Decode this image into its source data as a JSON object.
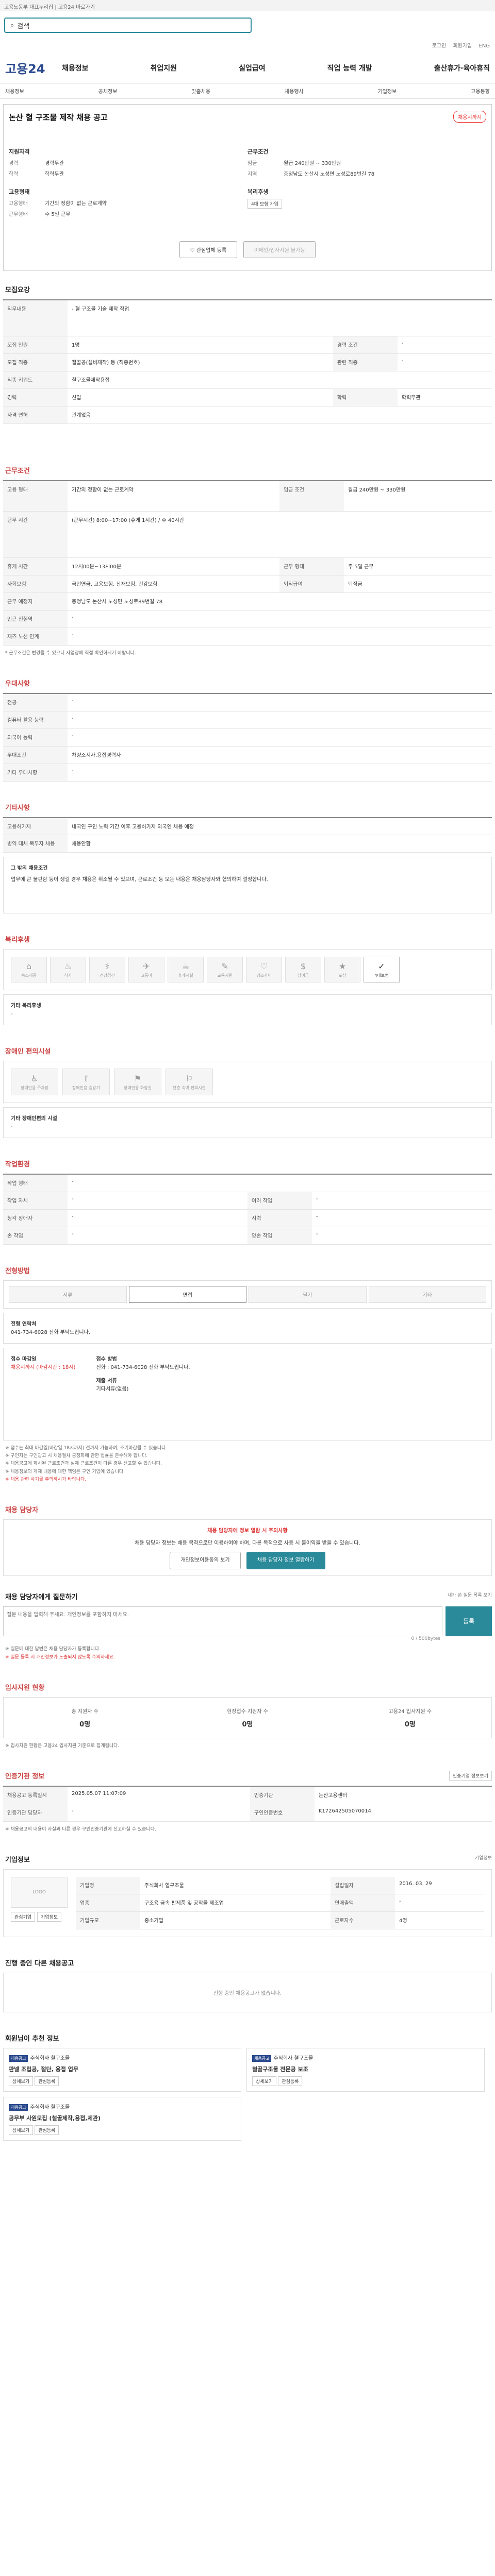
{
  "topbar": "고용노동부 대표누리집 | 고용24 바로가기",
  "search": {
    "placeholder": "검색어를 입력하세요",
    "value": "검색"
  },
  "util": [
    "로그인",
    "회원가입",
    "ENG"
  ],
  "logo": "고용24",
  "nav": [
    "채용정보",
    "취업지원",
    "실업급여",
    "직업 능력 개발",
    "출산휴가·육아휴직"
  ],
  "subnav": [
    "채용정보",
    "공채정보",
    "맞춤채용",
    "채용행사",
    "기업정보",
    "고용동향"
  ],
  "job": {
    "title": "논산 혈 구조물 제작 채용 공고",
    "badge": "채용시까지",
    "conditions_title": "지원자격",
    "cond_h": "근무조건",
    "cond": [
      {
        "k": "경력",
        "v": "경력무관"
      },
      {
        "k": "학력",
        "v": "학력무관"
      }
    ],
    "pay": [
      {
        "k": "임금",
        "v": "월급 240만원 ~ 330만원"
      },
      {
        "k": "지역",
        "v": "충청남도 논산시 노성면 노성로89번길 78"
      }
    ],
    "form_h": "고용형태",
    "form": [
      {
        "k": "고용형태",
        "v": "기간의 정함이 없는 근로계약"
      },
      {
        "k": "근무형태",
        "v": "주 5일 근무"
      }
    ],
    "period_h": "복리후생",
    "period": [
      {
        "k": "",
        "v": "4대 보험 가입"
      }
    ],
    "save": "관심업체 등록",
    "apply": "이메일/입사지원 불가능"
  },
  "sec_recruit": "모집요강",
  "recruit_rows": [
    {
      "h": "직무내용",
      "v": "- 혈 구조물 기술 제작 작업"
    },
    {
      "h": "모집 인원",
      "v": "1명",
      "h2": "경력 조건",
      "v2": "-"
    },
    {
      "h": "모집 직종",
      "v": "철골공(설비제작) 등 (직종번호)",
      "h2": "관련 직종",
      "v2": "-"
    },
    {
      "h": "직종 키워드",
      "v": "철구조물제작용접"
    },
    {
      "h": "경력",
      "v": "신입",
      "h2": "학력",
      "v2": "학력무관"
    },
    {
      "h": "자격 면허",
      "v": "관계없음"
    }
  ],
  "sec_cond": "근무조건",
  "cond_rows": [
    {
      "h": "고용 형태",
      "v": "기간의 정함이 없는 근로계약",
      "h2": "임금 조건",
      "v2": "월급 240만원 ~ 330만원"
    },
    {
      "h": "근무 시간",
      "v": "(근무시간) 8:00~17:00 (휴게 1시간) / 주 40시간"
    },
    {
      "h": "휴게 시간",
      "v": "12시00분~13시00분",
      "h2": "근무 형태",
      "v2": "주 5일 근무"
    },
    {
      "h": "사회보험",
      "v": "국민연금, 고용보험, 산재보험, 건강보험",
      "h2": "퇴직급여",
      "v2": "퇴직금"
    },
    {
      "h": "근무 예정지",
      "v": "충청남도 논산시 노성면 노성로89번길 78"
    },
    {
      "h": "인근 전철역",
      "v": "-"
    },
    {
      "h": "재즈 노선 연계",
      "v": "-"
    }
  ],
  "cond_note": "* 근무조건은 변경될 수 있으니 사업장에 직접 확인하시기 바랍니다.",
  "sec_pref": "우대사항",
  "pref_rows": [
    {
      "h": "전공",
      "v": "-"
    },
    {
      "h": "컴퓨터 활용 능력",
      "v": "-"
    },
    {
      "h": "외국어 능력",
      "v": "-"
    },
    {
      "h": "우대조건",
      "v": "차량소지자,용접경력자"
    },
    {
      "h": "기타 우대사항",
      "v": "-"
    }
  ],
  "sec_etc": "기타사항",
  "etc_rows": [
    {
      "h": "고용허가제",
      "v": "내국인 구인 노력 기간 이후 고용허가제 외국인 채용 예정"
    },
    {
      "h": "병역 대체 복무자 채용",
      "v": "채용안함"
    }
  ],
  "etc_box_title": "그 밖의 채용조건",
  "etc_box_text": "업무에 큰 불편함 등이 생길 경우 채용은 취소될 수 있으며, 근로조건 등 모든 내용은 채용담당자와 협의하여 결정합니다.",
  "sec_welfare": "복리후생",
  "welfare_icons": [
    {
      "ic": "⌂",
      "l": "숙소제공",
      "on": false
    },
    {
      "ic": "♨",
      "l": "식사",
      "on": false
    },
    {
      "ic": "⚕",
      "l": "건강검진",
      "on": false
    },
    {
      "ic": "✈",
      "l": "교통비",
      "on": false
    },
    {
      "ic": "☕",
      "l": "휴게시설",
      "on": false
    },
    {
      "ic": "✎",
      "l": "교육지원",
      "on": false
    },
    {
      "ic": "♡",
      "l": "경조사비",
      "on": false
    },
    {
      "ic": "$",
      "l": "상여금",
      "on": false
    },
    {
      "ic": "★",
      "l": "포상",
      "on": false
    },
    {
      "ic": "✓",
      "l": "4대보험",
      "on": true
    }
  ],
  "welfare_other_h": "기타 복리후생",
  "welfare_other_v": "-",
  "sec_disability": "장애인 편의시설",
  "disability_icons": [
    {
      "ic": "♿",
      "l": "장애인용 주차장"
    },
    {
      "ic": "⇧",
      "l": "장애인용 승강기"
    },
    {
      "ic": "⚑",
      "l": "장애인용 화장실"
    },
    {
      "ic": "⚐",
      "l": "단층 숙박 편의시설"
    }
  ],
  "disability_other_h": "기타 장애인편의 시설",
  "disability_other_v": "-",
  "sec_env": "작업환경",
  "env_rows": [
    {
      "h": "작업 형태",
      "v": "-"
    },
    {
      "h": "작업 자세",
      "v": "-",
      "h2": "여러 작업",
      "v2": "-"
    },
    {
      "h": "청각 장애자",
      "v": "-",
      "h2": "시력",
      "v2": "-"
    },
    {
      "h": "손 작업",
      "v": "-",
      "h2": "양손 작업",
      "v2": "-"
    }
  ],
  "sec_method": "전형방법",
  "methods": [
    {
      "l": "서류",
      "on": false
    },
    {
      "l": "면접",
      "on": true
    },
    {
      "l": "필기",
      "on": false
    },
    {
      "l": "기타",
      "on": false
    }
  ],
  "method_contact_h": "전형 연락처",
  "method_contact": "041-734-6028 전화 부탁드립니다.",
  "method_apply_h": "접수 마감일",
  "method_apply_v": "채용시까지 (마감시간 : 18시)",
  "method_how_h": "접수 방법",
  "method_how_v": "전화 : 041-734-6028 전화 부탁드립니다.",
  "method_docs_h": "제출 서류",
  "method_docs_v": "기타서류(없음)",
  "notices": [
    "※ 접수는 최대 마감일(마감일 18시까지) 전까지 가능하며, 조기마감될 수 있습니다.",
    "※ 구인자는 구인광고 시 채용절차 공정화에 관한 법률을 준수해야 합니다.",
    "※ 채용공고에 제시된 근로조건과 실제 근로조건이 다른 경우 신고할 수 있습니다.",
    "※ 채용정보의 게재 내용에 대한 책임은 구인 기업에 있습니다.",
    "※ 채용 관련 사기를 주의하시기 바랍니다."
  ],
  "sec_contact": "채용 담당자",
  "contact_title": "채용 담당자에 정보 열람 시 주의사항",
  "contact_text": "채용 담당자 정보는 채용 목적으로만 이용하여야 하며, 다른 목적으로 사용 시 불이익을 받을 수 있습니다.",
  "contact_btn1": "개인정보이용동의 보기",
  "contact_btn2": "채용 담당자 정보 열람하기",
  "sec_ask": "채용 담당자에게 질문하기",
  "ask_link": "내가 쓴 질문 목록 보기",
  "ask_placeholder": "질문 내용을 입력해 주세요. 개인정보를 포함하지 마세요.",
  "ask_count": "0 / 500bytes",
  "ask_btn": "등록",
  "ask_notes": [
    "※ 질문에 대한 답변은 채용 담당자가 등록합니다.",
    "※ 질문 등록 시 개인정보가 노출되지 않도록 주의하세요."
  ],
  "sec_stats": "입사지원 현황",
  "stats": [
    {
      "l": "총 지원자 수",
      "v": "0명"
    },
    {
      "l": "현장접수 지원자 수",
      "v": "0명"
    },
    {
      "l": "고용24 입사지원 수",
      "v": "0명"
    }
  ],
  "stats_note": "※ 입사지원 현황은 고용24 입사지원 기준으로 집계됩니다.",
  "sec_auth": "인증기관 정보",
  "auth_btn": "인증기업 정보보기",
  "auth_rows": [
    {
      "h": "채용공고 등록일시",
      "v": "2025.05.07 11:07:09",
      "h2": "인증기관",
      "v2": "논산고용센터"
    },
    {
      "h": "인증기관 담당자",
      "v": "-",
      "h2": "구인인증번호",
      "v2": "K172642505070014"
    }
  ],
  "auth_note": "※ 채용공고의 내용이 사실과 다른 경우 구인인증기관에 신고하실 수 있습니다.",
  "sec_company": "기업정보",
  "company_more": "기업정보",
  "company_logo": "LOGO",
  "company_rows": [
    {
      "h": "기업명",
      "v": "주식회사 혈구조물",
      "h2": "설립일자",
      "v2": "2016. 03. 29"
    },
    {
      "h": "업종",
      "v": "구조용 금속 판제품 및 공작물 제조업",
      "h2": "연매출액",
      "v2": "-"
    },
    {
      "h": "기업규모",
      "v": "중소기업",
      "h2": "근로자수",
      "v2": "4명"
    }
  ],
  "company_btns": [
    "관심기업",
    "기업정보"
  ],
  "sec_other": "진행 중인 다른 채용공고",
  "other_empty": "진행 중인 채용공고가 없습니다.",
  "sec_rec": "회원님이 추천 정보",
  "rec_cards": [
    {
      "tag": "채용공고",
      "co": "주식회사 혈구조물",
      "t": "판넬 조립공, 절단, 용접 업무",
      "btn1": "상세보기",
      "btn2": "관심등록"
    },
    {
      "tag": "채용공고",
      "co": "주식회사 혈구조물",
      "t": "철골구조물 전문공 보조",
      "btn1": "상세보기",
      "btn2": "관심등록"
    },
    {
      "tag": "채용공고",
      "co": "주식회사 혈구조물",
      "t": "공무부 사원모집 (철골제작,용접,제관)",
      "btn1": "상세보기",
      "btn2": "관심등록"
    }
  ]
}
